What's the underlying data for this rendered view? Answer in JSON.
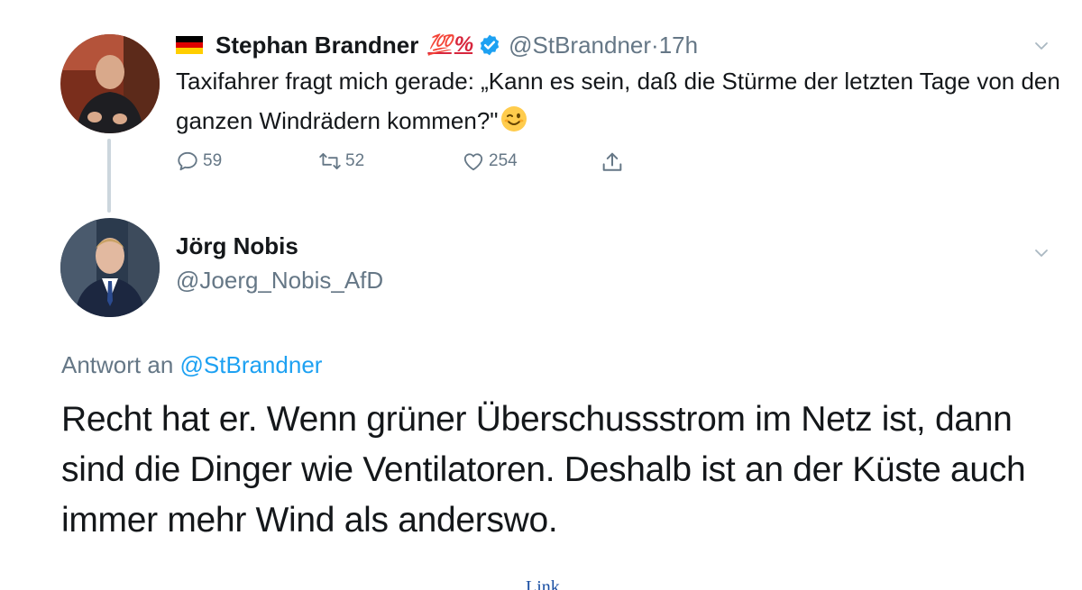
{
  "tweet1": {
    "author_name": "Stephan Brandner",
    "name_badge": "💯%",
    "handle": "@StBrandner",
    "separator": "·",
    "time": "17h",
    "text": "Taxifahrer fragt mich gerade: „Kann es sein, daß die Stürme der letzten Tage von den ganzen Windrädern kommen?\"",
    "actions": {
      "replies": "59",
      "retweets": "52",
      "likes": "254"
    },
    "icons": [
      "german-flag-icon",
      "hundred-points-icon",
      "verified-badge-icon",
      "winking-face-icon",
      "reply-icon",
      "retweet-icon",
      "like-icon",
      "share-icon",
      "chevron-down-icon"
    ]
  },
  "tweet2": {
    "author_name": "Jörg Nobis",
    "handle": "@Joerg_Nobis_AfD",
    "reply_prefix": "Antwort an ",
    "reply_mention": "@StBrandner",
    "text": "Recht hat er. Wenn grüner Überschussstrom im Netz ist, dann sind die Dinger wie Ventilatoren. Deshalb ist an der Küste auch immer mehr Wind als anderswo.",
    "icons": [
      "chevron-down-icon"
    ]
  },
  "footer": {
    "link_text": "Link"
  },
  "colors": {
    "text": "#14171a",
    "secondary": "#657786",
    "accent": "#1da1f2",
    "thread_line": "#ccd6dd"
  }
}
